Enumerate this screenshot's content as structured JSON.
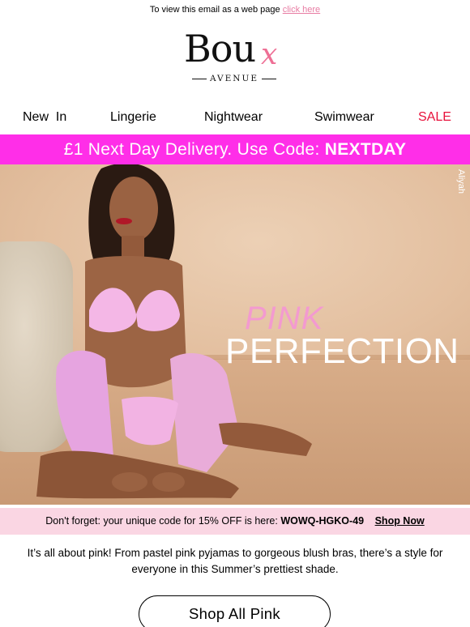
{
  "preheader": {
    "text": "To view this email as a web page",
    "link_label": "click here"
  },
  "brand": {
    "logo_word": "Bou",
    "logo_x": "x",
    "logo_sub": "AVENUE"
  },
  "nav": {
    "items": [
      {
        "label": "New  In"
      },
      {
        "label": "Lingerie"
      },
      {
        "label": "Nightwear"
      },
      {
        "label": "Swimwear"
      },
      {
        "label": "SALE"
      }
    ]
  },
  "promo": {
    "text": "£1 Next Day Delivery. Use Code:",
    "code": "NEXTDAY"
  },
  "hero": {
    "credit": "Aliyah",
    "title_line_1": "PINK",
    "title_line_2": "PERFECTION"
  },
  "code_bar": {
    "text": "Don't forget: your unique code for 15% OFF is here:",
    "code": "WOWQ-HGKO-49",
    "link_label": "Shop Now"
  },
  "body": {
    "line_1": "It’s all about pink! From pastel pink pyjamas to gorgeous blush bras, there’s a style for",
    "line_2": "everyone in this Summer’s prettiest shade."
  },
  "cta": {
    "label": "Shop All Pink"
  },
  "colors": {
    "promo_bg": "#ff2ee8",
    "code_bar_bg": "#fad6e3",
    "sale": "#e8113b",
    "link": "#e87ca3",
    "hero_title_pink": "#f39ad0"
  }
}
